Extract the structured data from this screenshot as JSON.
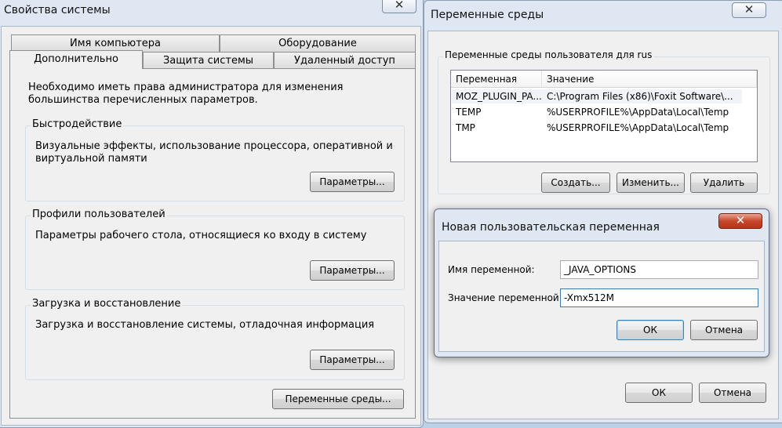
{
  "system_properties": {
    "title": "Свойства системы",
    "close": "✕",
    "tabs_row1": [
      "Имя компьютера",
      "Оборудование"
    ],
    "tabs_row2": [
      "Дополнительно",
      "Защита системы",
      "Удаленный доступ"
    ],
    "intro": "Необходимо иметь права администратора для изменения большинства перечисленных параметров.",
    "performance": {
      "label": "Быстродействие",
      "text": "Визуальные эффекты, использование процессора, оперативной и виртуальной памяти",
      "button": "Параметры..."
    },
    "profiles": {
      "label": "Профили пользователей",
      "text": "Параметры рабочего стола, относящиеся ко входу в систему",
      "button": "Параметры..."
    },
    "startup": {
      "label": "Загрузка и восстановление",
      "text": "Загрузка и восстановление системы, отладочная информация",
      "button": "Параметры..."
    },
    "env_button": "Переменные среды..."
  },
  "env_vars": {
    "title": "Переменные среды",
    "close": "✕",
    "user_group_label": "Переменные среды пользователя для rus",
    "columns": [
      "Переменная",
      "Значение"
    ],
    "rows": [
      {
        "name": "MOZ_PLUGIN_PA...",
        "value": "C:\\Program Files (x86)\\Foxit Software\\..."
      },
      {
        "name": "TEMP",
        "value": "%USERPROFILE%\\AppData\\Local\\Temp"
      },
      {
        "name": "TMP",
        "value": "%USERPROFILE%\\AppData\\Local\\Temp"
      }
    ],
    "btn_create": "Создать...",
    "btn_edit": "Изменить...",
    "btn_delete": "Удалить",
    "btn_ok": "ОК",
    "btn_cancel": "Отмена"
  },
  "new_var": {
    "title": "Новая пользовательская переменная",
    "close": "✕",
    "name_label": "Имя переменной:",
    "name_value": "_JAVA_OPTIONS",
    "value_label": "Значение переменной:",
    "value_value": "-Xmx512M",
    "btn_ok": "ОК",
    "btn_cancel": "Отмена"
  }
}
